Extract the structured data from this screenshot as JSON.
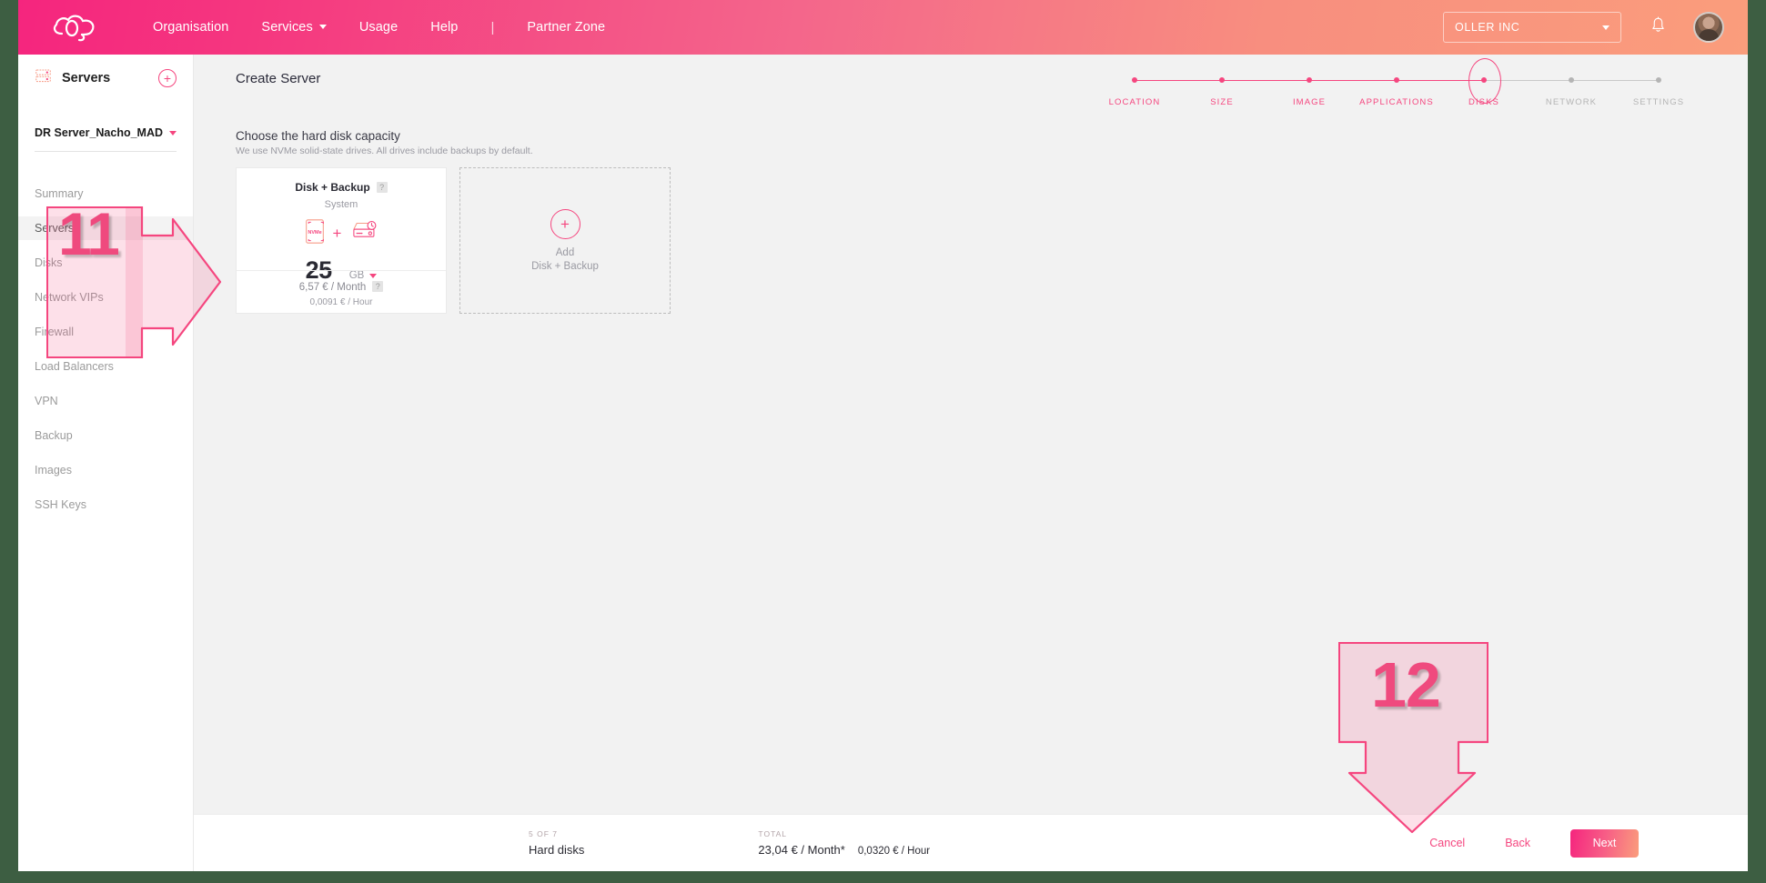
{
  "topnav": {
    "logo_name": "cloud-logo",
    "links": [
      {
        "label": "Organisation",
        "dropdown": false
      },
      {
        "label": "Services",
        "dropdown": true
      },
      {
        "label": "Usage",
        "dropdown": false
      },
      {
        "label": "Help",
        "dropdown": false
      }
    ],
    "separator": "|",
    "partner_zone": "Partner Zone",
    "org_selector": "OLLER INC",
    "bell_icon": "notification-bell-icon",
    "avatar_icon": "user-avatar"
  },
  "sidebar": {
    "icon": "servers-icon",
    "title": "Servers",
    "add_label": "+",
    "server_name": "DR Server_Nacho_MAD",
    "items": [
      {
        "label": "Summary",
        "active": false
      },
      {
        "label": "Servers",
        "active": true
      },
      {
        "label": "Disks",
        "active": false
      },
      {
        "label": "Network VIPs",
        "active": false
      },
      {
        "label": "Firewall",
        "active": false
      },
      {
        "label": "Load Balancers",
        "active": false
      },
      {
        "label": "VPN",
        "active": false
      },
      {
        "label": "Backup",
        "active": false
      },
      {
        "label": "Images",
        "active": false
      },
      {
        "label": "SSH Keys",
        "active": false
      }
    ]
  },
  "main": {
    "page_title": "Create Server",
    "section_title": "Choose the hard disk capacity",
    "section_subtitle": "We use NVMe solid-state drives. All drives include backups by default.",
    "stepper": [
      {
        "label": "LOCATION",
        "state": "done"
      },
      {
        "label": "SIZE",
        "state": "done"
      },
      {
        "label": "IMAGE",
        "state": "done"
      },
      {
        "label": "APPLICATIONS",
        "state": "done"
      },
      {
        "label": "DISKS",
        "state": "current"
      },
      {
        "label": "NETWORK",
        "state": "todo"
      },
      {
        "label": "SETTINGS",
        "state": "todo"
      }
    ],
    "disk_card": {
      "title": "Disk + Backup",
      "help": "?",
      "subtitle": "System",
      "nvme_icon": "nvme-disk-icon",
      "nvme_label": "NVMe",
      "plus": "+",
      "backup_icon": "backup-drive-icon",
      "size_value": "25",
      "size_unit": "GB",
      "price_month": "6,57 € / Month",
      "price_month_help": "?",
      "price_hour": "0,0091 € / Hour"
    },
    "add_card": {
      "plus": "+",
      "line1": "Add",
      "line2": "Disk + Backup"
    }
  },
  "footer": {
    "step_caption": "5 OF 7",
    "step_value": "Hard disks",
    "total_caption": "TOTAL",
    "total_month": "23,04 € / Month*",
    "total_hour": "0,0320 € / Hour",
    "cancel_label": "Cancel",
    "back_label": "Back",
    "next_label": "Next"
  },
  "annotations": {
    "step11": "11",
    "step12": "12"
  },
  "colors": {
    "brand_pink": "#f5467f",
    "brand_peach": "#fa9d7c",
    "page_bg": "#f2f2f2",
    "frame_border": "#3d5e42"
  }
}
